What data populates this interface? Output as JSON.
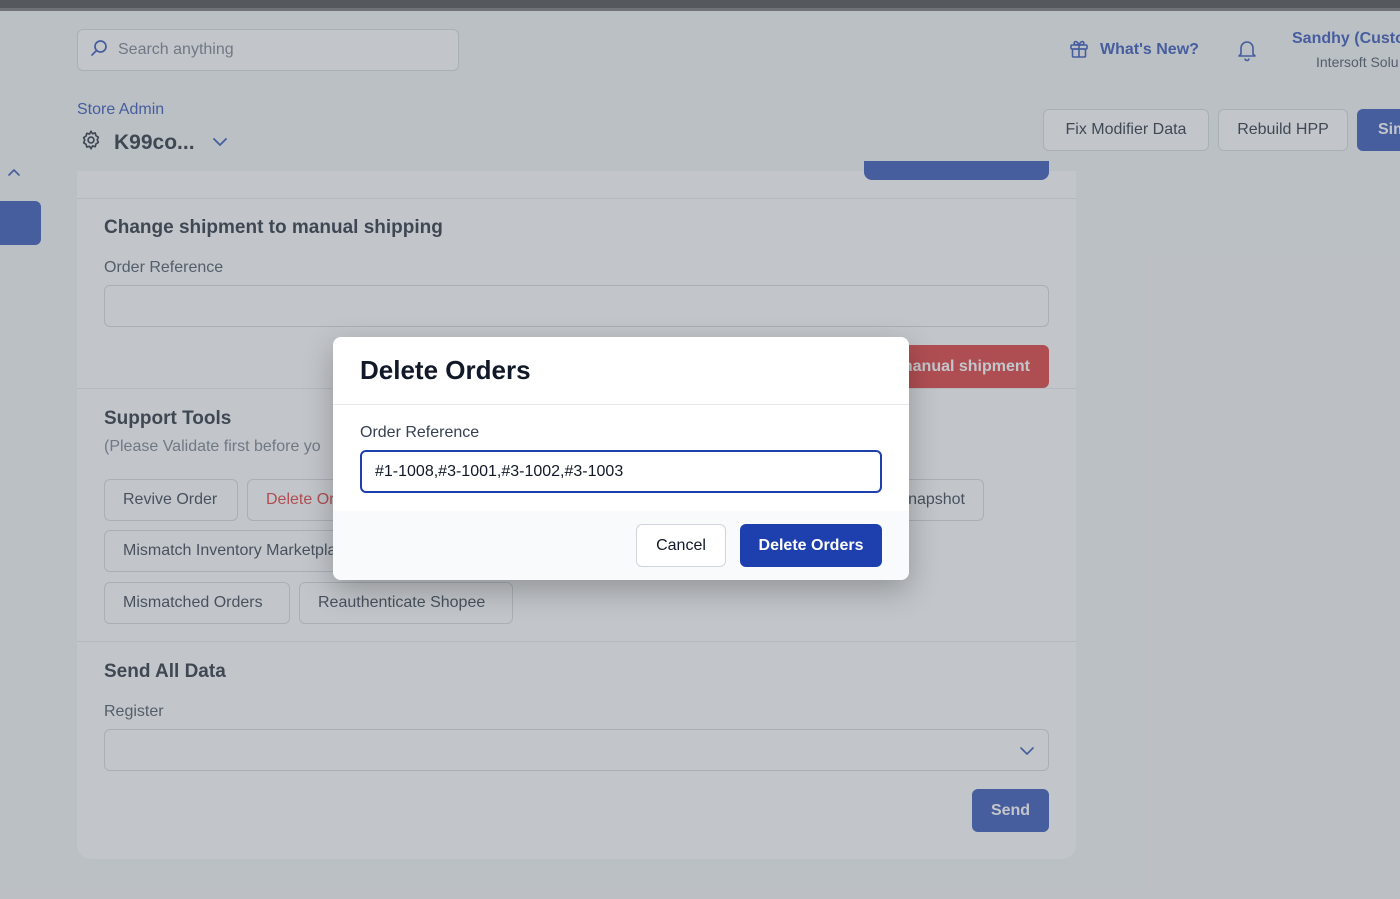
{
  "header": {
    "search_placeholder": "Search anything",
    "whats_new_label": "What's New?",
    "user_name": "Sandhy (Custo",
    "user_org": "Intersoft Solu"
  },
  "store": {
    "breadcrumb": "Store Admin",
    "name": "K99co...",
    "actions": {
      "fix_modifier": "Fix Modifier Data",
      "rebuild_hpp": "Rebuild HPP",
      "primary": "Sim"
    }
  },
  "manual_shipping": {
    "title": "Change shipment to manual shipping",
    "field_label": "Order Reference",
    "button_label": "Change to manual shipment"
  },
  "support_tools": {
    "title": "Support Tools",
    "helper": "(Please Validate first before yo",
    "tools": {
      "revive_order": "Revive Order",
      "delete_orders": "Delete Orders",
      "snapshot": "Snapshot",
      "mismatch_inventory": "Mismatch Inventory Marketplace",
      "mismatched_orders": "Mismatched Orders",
      "reauth_shopee": "Reauthenticate Shopee"
    }
  },
  "send_all": {
    "title": "Send All Data",
    "register_label": "Register",
    "send_label": "Send"
  },
  "modal": {
    "title": "Delete Orders",
    "field_label": "Order Reference",
    "field_value": "#1-1008,#3-1001,#3-1002,#3-1003",
    "cancel_label": "Cancel",
    "confirm_label": "Delete Orders"
  },
  "colors": {
    "primary": "#1e40af",
    "danger": "#dc2626"
  }
}
